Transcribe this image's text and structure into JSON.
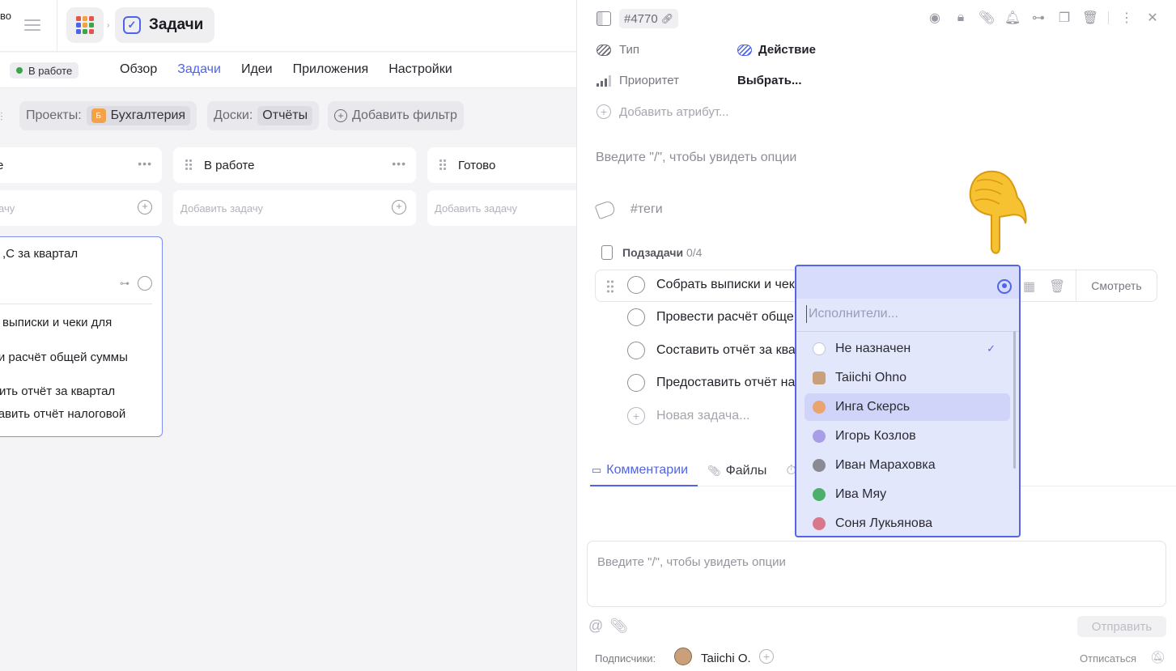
{
  "left_pane": {
    "top_fragment": "во",
    "breadcrumb": {
      "title": "Задачи"
    },
    "status_pill": {
      "label": "В работе",
      "color": "#3ca54a"
    },
    "nav_tabs": [
      {
        "label": "Обзор"
      },
      {
        "label": "Задачи",
        "active": true
      },
      {
        "label": "Идеи"
      },
      {
        "label": "Приложения"
      },
      {
        "label": "Настройки"
      }
    ],
    "filters": {
      "projects_label": "Проекты:",
      "projects_value": "Бухгалтерия",
      "projects_badge": "Б",
      "boards_label": "Доски:",
      "boards_value": "Отчёты",
      "add_filter": "Добавить фильтр"
    },
    "columns": [
      {
        "title": "е",
        "add_placeholder": "ачу"
      },
      {
        "title": "В работе",
        "add_placeholder": "Добавить задачу"
      },
      {
        "title": "Готово",
        "add_placeholder": "Добавить задачу"
      }
    ],
    "task_card": {
      "title": ",С за квартал",
      "subtasks": [
        "ь выписки и чеки для",
        "ти расчёт общей суммы",
        "вить отчёт за квартал",
        "тавить отчёт налоговой"
      ]
    }
  },
  "right_pane": {
    "task_id": "#4770",
    "attributes": [
      {
        "label": "Тип",
        "value": "Действие"
      },
      {
        "label": "Приоритет",
        "value": "Выбрать..."
      }
    ],
    "add_attribute": "Добавить атрибут...",
    "editor_placeholder": "Введите \"/\", чтобы увидеть опции",
    "tags_placeholder": "#теги",
    "subtasks_header": {
      "label": "Подзадачи",
      "count": "0/4"
    },
    "subtasks": [
      "Собрать выписки и чеки для отчёта",
      "Провести расчёт обще",
      "Составить отчёт за ква",
      "Предоставить отчёт на"
    ],
    "view_button": "Смотреть",
    "new_task": "Новая задача...",
    "tabs": [
      {
        "label": "Комментарии",
        "active": true
      },
      {
        "label": "Файлы"
      }
    ],
    "comment_placeholder": "Введите \"/\", чтобы увидеть опции",
    "send_button": "Отправить",
    "subscribers_label": "Подписчики:",
    "subscriber_name": "Taiichi O.",
    "unsubscribe": "Отписаться"
  },
  "dropdown": {
    "search_placeholder": "Исполнители...",
    "options": [
      {
        "label": "Не назначен",
        "selected": true,
        "color": "#c9cbe0"
      },
      {
        "label": "Taiichi Ohno",
        "color": "#c9a07a"
      },
      {
        "label": "Инга Скерсь",
        "color": "#e9a46f",
        "hover": true
      },
      {
        "label": "Игорь Козлов",
        "color": "#a99de8"
      },
      {
        "label": "Иван Мараховка",
        "color": "#8a8a92"
      },
      {
        "label": "Ива Мяу",
        "color": "#4caf6a"
      },
      {
        "label": "Соня Лукьянова",
        "color": "#d9788a"
      }
    ]
  },
  "colors": {
    "accent": "#4f64e8",
    "selection_border": "#5565e6"
  }
}
